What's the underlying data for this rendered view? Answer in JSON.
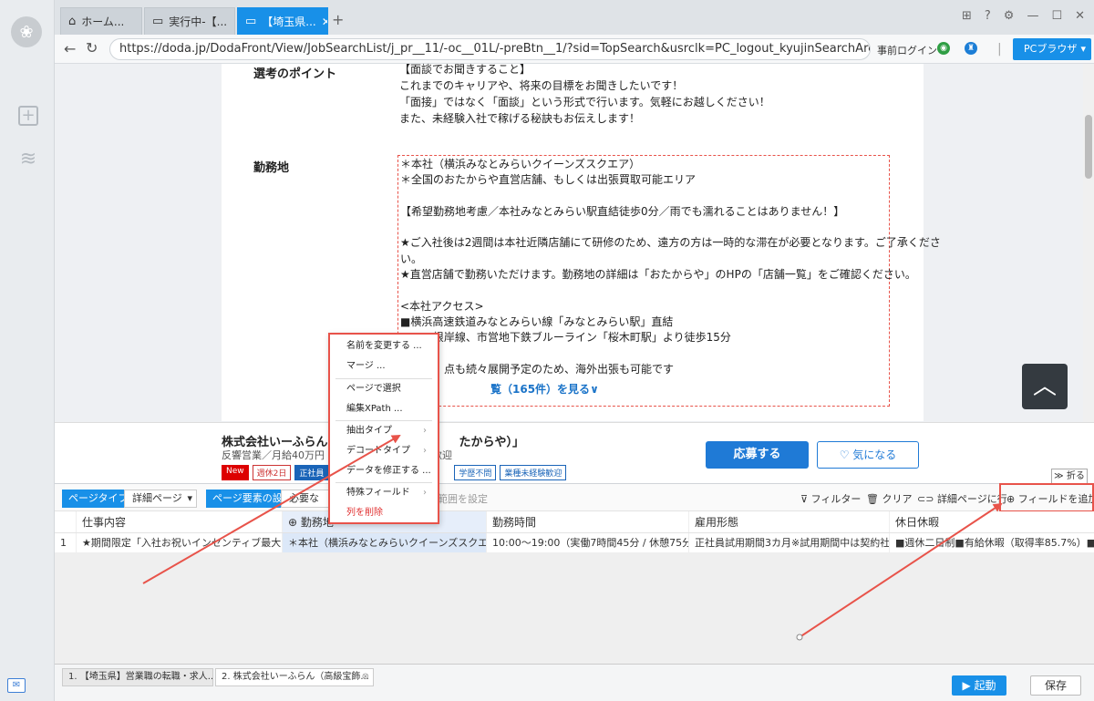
{
  "tabs": [
    {
      "label": "ホーム..."
    },
    {
      "label": "実行中-【..."
    },
    {
      "label": "【埼玉県..."
    }
  ],
  "address": {
    "url": "https://doda.jp/DodaFront/View/JobSearchList/j_pr__11/-oc__01L/-preBtn__1/?sid=TopSearch&usrclk=PC_logout_kyujinSearchArea_searchButton_loc-job",
    "login": "事前ログイン",
    "browser_button": "PCブラウザ"
  },
  "job": {
    "sel_heading": "選考のポイント",
    "sel_lines": [
      "【面談でお聞きすること】",
      "これまでのキャリアや、将来の目標をお聞きしたいです！",
      "「面接」ではなく「面談」という形式で行います。気軽にお越しください！",
      "また、未経験入社で稼げる秘訣もお伝えします！"
    ],
    "loc_heading": "勤務地",
    "loc_lines": [
      "＊本社（横浜みなとみらいクイーンズスクエア）",
      "＊全国のおたからや直営店舗、もしくは出張買取可能エリア",
      "",
      "【希望勤務地考慮／本社みなとみらい駅直結徒歩0分／雨でも濡れることはありません！】",
      "",
      "★ご入社後は2週間は本社近隣店舗にて研修のため、遠方の方は一時的な滞在が必要となります。ご了承くださ",
      "い。",
      "★直営店舗で勤務いただけます。勤務地の詳細は「おたからや」のHPの「店舗一覧」をご確認ください。",
      "",
      "<本社アクセス>",
      "■横浜高速鉄道みなとみらい線「みなとみらい駅」直結",
      "　　JR根岸線、市営地下鉄ブルーライン「桜木町駅」より徒歩15分",
      "",
      "　　　　点も続々展開予定のため、海外出張も可能です"
    ],
    "more": "覧（165件）を見る"
  },
  "jobbar": {
    "company": "株式会社いーふらん（高",
    "company_tail": "たからや）」",
    "subtitle": "反響営業／月給40万円",
    "subtitle_tail": "歓迎",
    "tags": [
      "New",
      "週休2日",
      "正社員"
    ],
    "tags2": [
      "学歴不問",
      "業種未経験歓迎"
    ],
    "apply": "応募する",
    "favorite": "気になる"
  },
  "panel": {
    "fold": "折る",
    "page_type_label": "ページタイプ",
    "page_type_value": "詳細ページ",
    "page_settings_label": "ページ要素の設定",
    "page_settings_value": "必要な",
    "range": "範囲を設定",
    "filter": "フィルター",
    "clear": "クリア",
    "detail": "詳細ページに行く",
    "add_field": "フィールドを追加",
    "columns": [
      "仕事内容",
      "勤務地",
      "勤務時間",
      "雇用形態",
      "休日休暇"
    ],
    "row_index": "1",
    "row": [
      "★期間限定「入社お祝いインセンティブ最大50万...",
      "＊本社（横浜みなとみらいクイーンズスクエア）...",
      "10:00～19:00（実働7時間45分 / 休憩75分）★基本...",
      "正社員試用期間3カ月※試用期間中は契約社員とな...",
      "■週休二日制■有給休暇（取得率85.7%）■夏季休暇"
    ]
  },
  "menu": {
    "items": [
      "名前を変更する ...",
      "マージ ...",
      "ページで選択",
      "編集XPath ...",
      "抽出タイプ",
      "デコードタイプ",
      "データを修正する ...",
      "特殊フィールド",
      "列を削除"
    ]
  },
  "bottom": {
    "tabs": [
      "1. 【埼玉県】営業職の転職・求人...",
      "2. 株式会社いーふらん（高級宝飾..."
    ],
    "start": "起動",
    "save": "保存"
  },
  "colors": {
    "accent": "#1890e8",
    "highlight": "#e8534a"
  }
}
